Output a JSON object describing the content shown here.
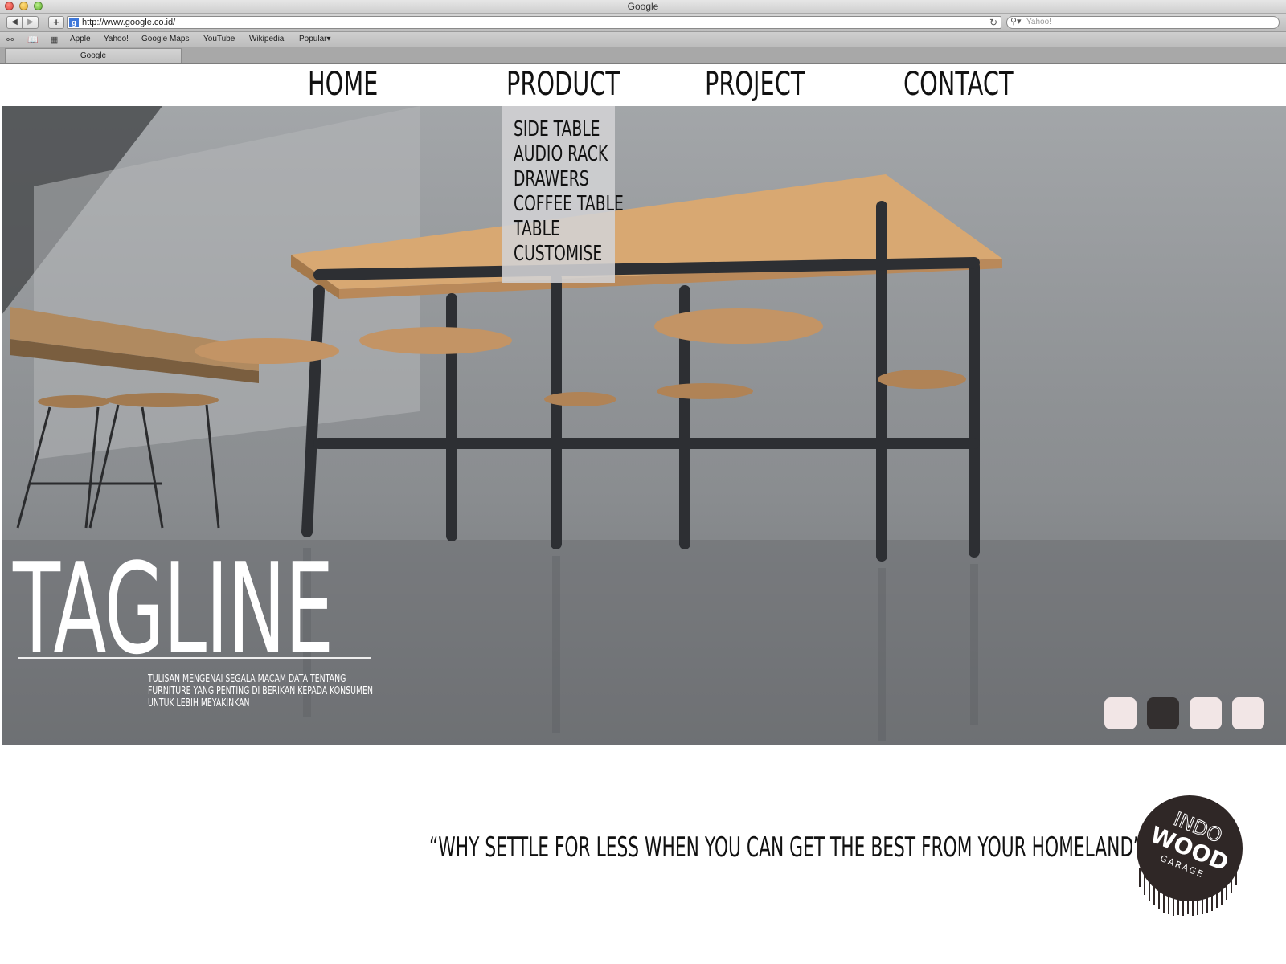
{
  "browser": {
    "window_title": "Google",
    "url": "http://www.google.co.id/",
    "search_placeholder": "Yahoo!",
    "bookmarks": [
      "Apple",
      "Yahoo!",
      "Google Maps",
      "YouTube",
      "Wikipedia",
      "Popular"
    ],
    "tab_title": "Google"
  },
  "nav": {
    "items": [
      "HOME",
      "PRODUCT",
      "PROJECT",
      "CONTACT"
    ],
    "product_menu": [
      "SIDE TABLE",
      "AUDIO RACK",
      "DRAWERS",
      "COFFEE TABLE",
      "TABLE",
      "CUSTOMISE"
    ]
  },
  "hero": {
    "tagline": "TAGLINE",
    "description": "TULISAN MENGENAI SEGALA MACAM DATA TENTANG FURNITURE YANG PENTING DI BERIKAN KEPADA KONSUMEN UNTUK LEBIH MEYAKINKAN",
    "slider": {
      "total": 4,
      "active_index": 2,
      "active_color": "#332f2f",
      "inactive_color": "#f2e6e6"
    }
  },
  "footer": {
    "quote": "“WHY SETTLE FOR LESS WHEN YOU CAN GET THE BEST FROM YOUR HOMELAND”",
    "logo": {
      "line1": "INDO",
      "line2": "WOOD",
      "line3": "GARAGE"
    }
  }
}
